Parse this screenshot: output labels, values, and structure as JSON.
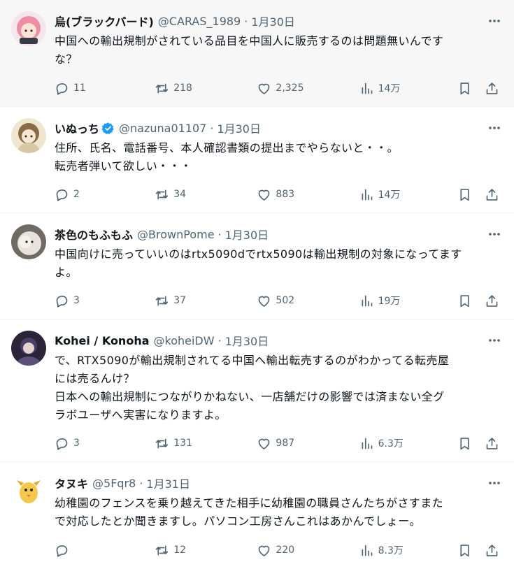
{
  "tweets": [
    {
      "name": "烏(ブラックバード)",
      "verified": false,
      "handle": "@CARAS_1989",
      "dot": "·",
      "date": "1月30日",
      "text": "中国への輸出規制がされている品目を中国人に販売するのは問題無いんです\nな？",
      "replies": "11",
      "retweets": "218",
      "likes": "2,325",
      "views": "14万",
      "avatar_color": "#e88aa0"
    },
    {
      "name": "いぬっち",
      "verified": true,
      "handle": "@nazuna01107",
      "dot": "·",
      "date": "1月30日",
      "text": "住所、氏名、電話番号、本人確認書類の提出までやらないと・・。\n転売者弾いて欲しい・・・",
      "replies": "2",
      "retweets": "34",
      "likes": "883",
      "views": "14万",
      "avatar_color": "#c9b48a"
    },
    {
      "name": "茶色のもふもふ",
      "verified": false,
      "handle": "@BrownPome",
      "dot": "·",
      "date": "1月30日",
      "text": "中国向けに売っていいのはrtx5090dでrtx5090は輸出規制の対象になってます\nよ。",
      "replies": "3",
      "retweets": "37",
      "likes": "502",
      "views": "19万",
      "avatar_color": "#b9b0a6"
    },
    {
      "name": "Kohei / Konoha",
      "verified": false,
      "handle": "@koheiDW",
      "dot": "·",
      "date": "1月30日",
      "text": "で、RTX5090が輸出規制されてる中国へ輸出転売するのがわかってる転売屋\nには売るんけ？\n日本への輸出規制につながりかねない、一店舗だけの影響では済まない全グ\nラボユーザへ実害になりますよ。",
      "replies": "3",
      "retweets": "131",
      "likes": "987",
      "views": "6.3万",
      "avatar_color": "#2e2a3a"
    },
    {
      "name": "タヌキ",
      "verified": false,
      "handle": "@5Fqr8",
      "dot": "·",
      "date": "1月31日",
      "text": "幼稚園のフェンスを乗り越えてきた相手に幼稚園の職員さんたちがさすまた\nで対応したとか聞きますし。パソコン工房さんこれはあかんでしょー。",
      "replies": "",
      "retweets": "12",
      "likes": "220",
      "views": "8.3万",
      "avatar_color": "#f2c94c"
    }
  ],
  "colors": {
    "text": "#0f1419",
    "muted": "#536471",
    "verified": "#1d9bf0",
    "highlight_bg": "#f7f7f7"
  },
  "icons": [
    "more-icon",
    "reply-icon",
    "retweet-icon",
    "like-icon",
    "views-icon",
    "bookmark-icon",
    "share-icon",
    "verified-badge-icon"
  ]
}
